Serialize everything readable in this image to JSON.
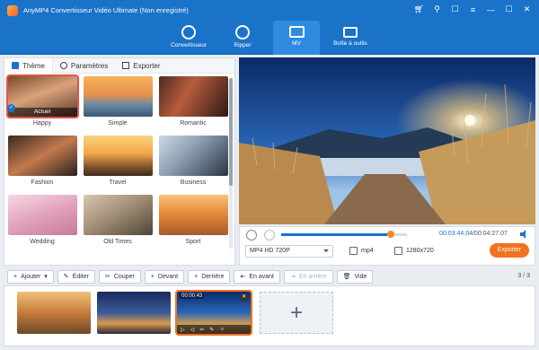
{
  "window": {
    "title": "AnyMP4 Convertisseur Vidéo Ultimate (Non enregistré)"
  },
  "nav": {
    "items": [
      {
        "label": "Convertisseur",
        "icon": "refresh-icon"
      },
      {
        "label": "Ripper",
        "icon": "disc-icon"
      },
      {
        "label": "MV",
        "icon": "image-icon",
        "active": true
      },
      {
        "label": "Boîte à outils",
        "icon": "toolbox-icon"
      }
    ]
  },
  "tabs": [
    {
      "label": "Thème",
      "icon": "grid-icon",
      "active": true
    },
    {
      "label": "Paramètres",
      "icon": "settings-icon"
    },
    {
      "label": "Exporter",
      "icon": "export-icon"
    }
  ],
  "themes": [
    {
      "label": "Happy",
      "selected": true,
      "badge": "Actuel"
    },
    {
      "label": "Simple"
    },
    {
      "label": "Romantic"
    },
    {
      "label": "Fashion"
    },
    {
      "label": "Travel"
    },
    {
      "label": "Business"
    },
    {
      "label": "Wedding"
    },
    {
      "label": "Old Times"
    },
    {
      "label": "Sport"
    }
  ],
  "player": {
    "current_time": "00:03:44.04",
    "total_time": "/00:04:27.07",
    "progress": 0.84,
    "preset": "MP4 HD 720P",
    "format": "mp4",
    "resolution": "1280x720",
    "export_label": "Exporter"
  },
  "toolbar": {
    "add": "Ajouter",
    "edit": "Éditer",
    "cut": "Couper",
    "front": "Devant",
    "back": "Derrière",
    "forward": "En avant",
    "backward": "En arrière",
    "empty": "Vide",
    "count": "3 / 3"
  },
  "clips": [
    {
      "time": ""
    },
    {
      "time": ""
    },
    {
      "time": "00:00:43",
      "selected": true
    }
  ],
  "colors": {
    "accent": "#1a73c9",
    "export": "#f37021"
  }
}
